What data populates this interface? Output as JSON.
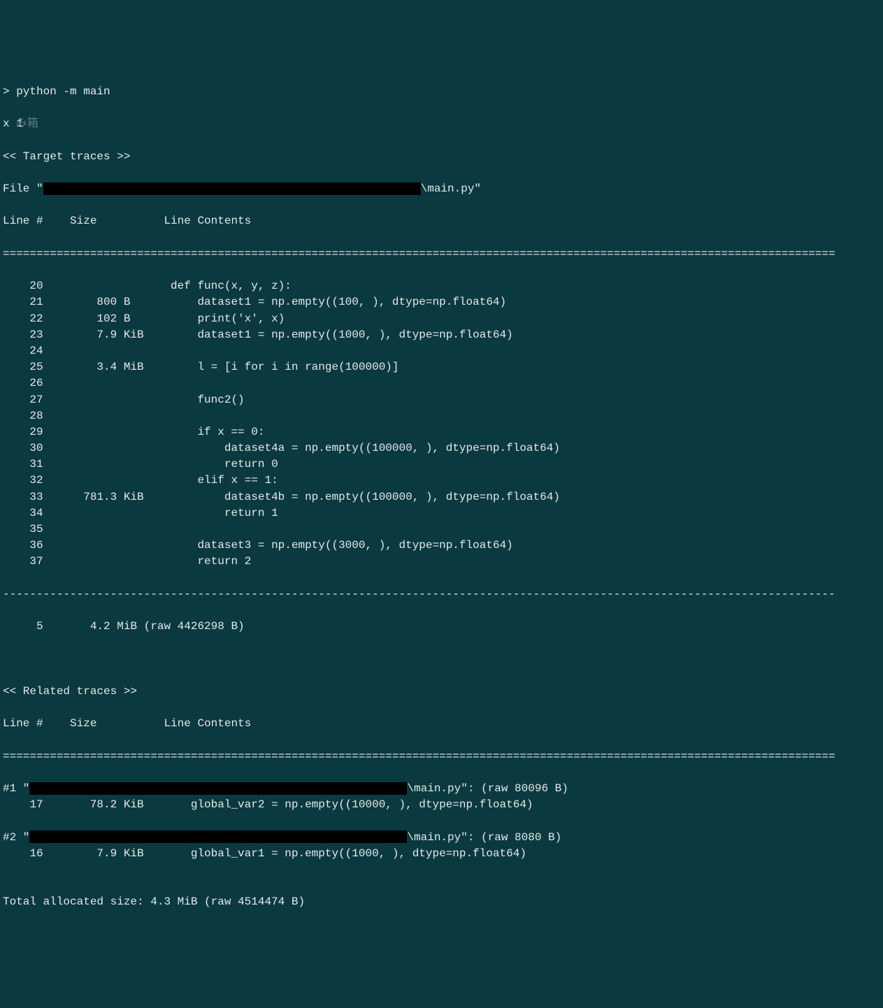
{
  "prompt": "> python -m main",
  "output_x": "x 1",
  "target_header": "<< Target traces >>",
  "file_prefix": "File \"",
  "file_suffix": "\\main.py\"",
  "column_header": "Line #    Size          Line Contents",
  "double_rule": "============================================================================================================================",
  "target_rows": [
    {
      "lineno": "    20",
      "size": "               ",
      "content": "def func(x, y, z):"
    },
    {
      "lineno": "    21",
      "size": "      800 B    ",
      "content": "    dataset1 = np.empty((100, ), dtype=np.float64)"
    },
    {
      "lineno": "    22",
      "size": "      102 B    ",
      "content": "    print('x', x)"
    },
    {
      "lineno": "    23",
      "size": "      7.9 KiB  ",
      "content": "    dataset1 = np.empty((1000, ), dtype=np.float64)"
    },
    {
      "lineno": "    24",
      "size": "               ",
      "content": ""
    },
    {
      "lineno": "    25",
      "size": "      3.4 MiB  ",
      "content": "    l = [i for i in range(100000)]"
    },
    {
      "lineno": "    26",
      "size": "               ",
      "content": ""
    },
    {
      "lineno": "    27",
      "size": "               ",
      "content": "    func2()"
    },
    {
      "lineno": "    28",
      "size": "               ",
      "content": ""
    },
    {
      "lineno": "    29",
      "size": "               ",
      "content": "    if x == 0:"
    },
    {
      "lineno": "    30",
      "size": "               ",
      "content": "        dataset4a = np.empty((100000, ), dtype=np.float64)"
    },
    {
      "lineno": "    31",
      "size": "               ",
      "content": "        return 0"
    },
    {
      "lineno": "    32",
      "size": "               ",
      "content": "    elif x == 1:"
    },
    {
      "lineno": "    33",
      "size": "    781.3 KiB  ",
      "content": "        dataset4b = np.empty((100000, ), dtype=np.float64)"
    },
    {
      "lineno": "    34",
      "size": "               ",
      "content": "        return 1"
    },
    {
      "lineno": "    35",
      "size": "               ",
      "content": ""
    },
    {
      "lineno": "    36",
      "size": "               ",
      "content": "    dataset3 = np.empty((3000, ), dtype=np.float64)"
    },
    {
      "lineno": "    37",
      "size": "               ",
      "content": "    return 2"
    }
  ],
  "dash_rule": "----------------------------------------------------------------------------------------------------------------------------",
  "target_total": "     5       4.2 MiB (raw 4426298 B)",
  "related_header": "<< Related traces >>",
  "related_column_header": "Line #    Size          Line Contents",
  "related_entries": [
    {
      "prefix": "#1 \"",
      "suffix": "\\main.py\": (raw 80096 B)",
      "lineno": "    17",
      "size": "     78.2 KiB  ",
      "content": "   global_var2 = np.empty((10000, ), dtype=np.float64)"
    },
    {
      "prefix": "#2 \"",
      "suffix": "\\main.py\": (raw 8080 B)",
      "lineno": "    16",
      "size": "      7.9 KiB  ",
      "content": "   global_var1 = np.empty((1000, ), dtype=np.float64)"
    }
  ],
  "total_line": "Total allocated size: 4.3 MiB (raw 4514474 B)",
  "bg_text": "み箱"
}
